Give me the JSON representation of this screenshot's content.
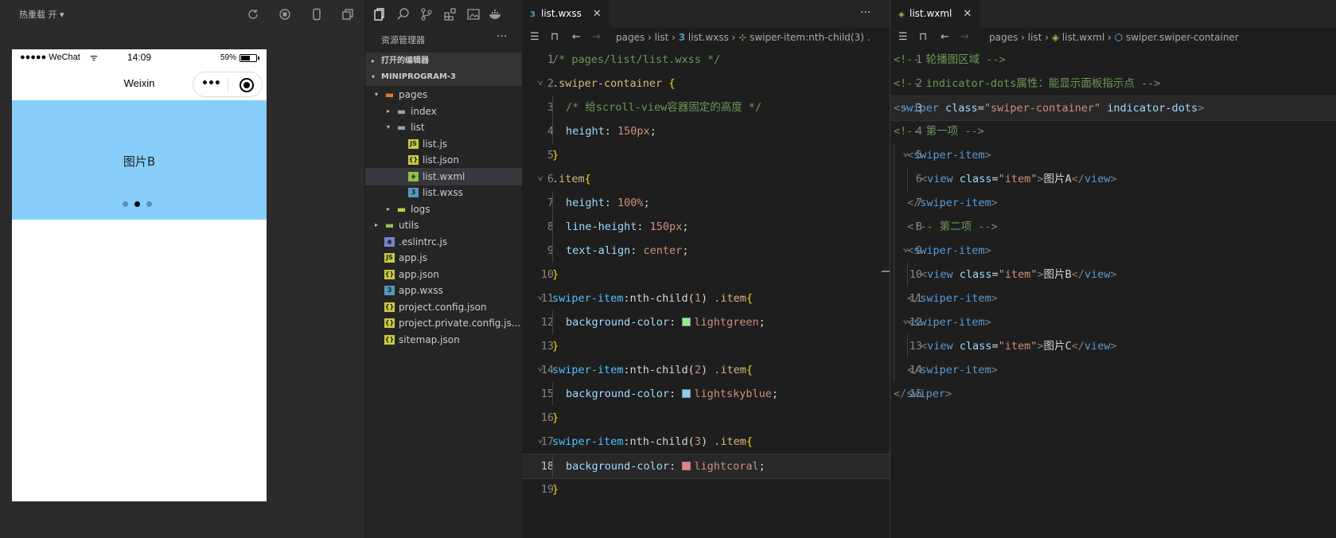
{
  "simulator": {
    "hot_reload": "热重载 开 ▾",
    "status": {
      "carrier": "●●●●● WeChat",
      "time": "14:09",
      "battery": "59%",
      "battery_level": 0.59
    },
    "nav_title": "Weixin",
    "capsule_more": "•••",
    "slide_text": "图片B",
    "dots": {
      "count": 3,
      "active_index": 1
    }
  },
  "explorer": {
    "title": "资源管理器",
    "more": "···",
    "sections": {
      "open_editors": "打开的编辑器",
      "project": "MINIPROGRAM-3"
    },
    "tree": [
      {
        "label": "pages",
        "icon": "folder-icon",
        "color": "#e37933",
        "level": 1,
        "twisty": "▾",
        "selected": false
      },
      {
        "label": "index",
        "icon": "folder-icon",
        "color": "#90a4ae",
        "level": 2,
        "twisty": "▸",
        "selected": false
      },
      {
        "label": "list",
        "icon": "folder-icon",
        "color": "#90a4ae",
        "level": 2,
        "twisty": "▾",
        "selected": false
      },
      {
        "label": "list.js",
        "icon": "js-file-icon",
        "color": "#cbcb41",
        "level": 3,
        "twisty": "",
        "selected": false
      },
      {
        "label": "list.json",
        "icon": "json-file-icon",
        "color": "#cbcb41",
        "level": 3,
        "twisty": "",
        "selected": false
      },
      {
        "label": "list.wxml",
        "icon": "wxml-file-icon",
        "color": "#8dc149",
        "level": 3,
        "twisty": "",
        "selected": true
      },
      {
        "label": "list.wxss",
        "icon": "css-file-icon",
        "color": "#519aba",
        "level": 3,
        "twisty": "",
        "selected": false
      },
      {
        "label": "logs",
        "icon": "folder-icon",
        "color": "#cbcb41",
        "level": 2,
        "twisty": "▸",
        "selected": false
      },
      {
        "label": "utils",
        "icon": "folder-icon",
        "color": "#8dc149",
        "level": 1,
        "twisty": "▸",
        "selected": false
      },
      {
        "label": ".eslintrc.js",
        "icon": "eslint-file-icon",
        "color": "#7986cb",
        "level": 1,
        "twisty": "",
        "selected": false
      },
      {
        "label": "app.js",
        "icon": "js-file-icon",
        "color": "#cbcb41",
        "level": 1,
        "twisty": "",
        "selected": false
      },
      {
        "label": "app.json",
        "icon": "json-file-icon",
        "color": "#cbcb41",
        "level": 1,
        "twisty": "",
        "selected": false
      },
      {
        "label": "app.wxss",
        "icon": "css-file-icon",
        "color": "#519aba",
        "level": 1,
        "twisty": "",
        "selected": false
      },
      {
        "label": "project.config.json",
        "icon": "json-file-icon",
        "color": "#cbcb41",
        "level": 1,
        "twisty": "",
        "selected": false
      },
      {
        "label": "project.private.config.js...",
        "icon": "json-file-icon",
        "color": "#cbcb41",
        "level": 1,
        "twisty": "",
        "selected": false
      },
      {
        "label": "sitemap.json",
        "icon": "json-file-icon",
        "color": "#cbcb41",
        "level": 1,
        "twisty": "",
        "selected": false
      }
    ]
  },
  "editor1": {
    "tab": "list.wxss",
    "tab_icon": "css-file-icon",
    "actions": "···",
    "breadcrumb": [
      "pages",
      "list",
      "list.wxss",
      "swiper-item:nth-child(3) ."
    ],
    "current_line": 18,
    "lines": [
      {
        "n": "1",
        "fold": "",
        "tokens": [
          [
            "/* pages/list/list.wxss */",
            "c-comment"
          ]
        ]
      },
      {
        "n": "2",
        "fold": "˅",
        "tokens": [
          [
            ".swiper-container",
            "c-sel"
          ],
          [
            " ",
            "c-white"
          ],
          [
            "{",
            "c-brace"
          ]
        ]
      },
      {
        "n": "3",
        "fold": "",
        "indent": 1,
        "tokens": [
          [
            "/* 给scroll-view容器固定的高度 */",
            "c-comment"
          ]
        ]
      },
      {
        "n": "4",
        "fold": "",
        "indent": 1,
        "tokens": [
          [
            "height",
            "c-prop"
          ],
          [
            ": ",
            "c-white"
          ],
          [
            "150px",
            "c-val"
          ],
          [
            ";",
            "c-white"
          ]
        ]
      },
      {
        "n": "5",
        "fold": "",
        "tokens": [
          [
            "}",
            "c-brace"
          ]
        ]
      },
      {
        "n": "6",
        "fold": "˅",
        "tokens": [
          [
            ".item",
            "c-sel"
          ],
          [
            "{",
            "c-brace"
          ]
        ]
      },
      {
        "n": "7",
        "fold": "",
        "indent": 1,
        "tokens": [
          [
            "height",
            "c-prop"
          ],
          [
            ": ",
            "c-white"
          ],
          [
            "100%",
            "c-val"
          ],
          [
            ";",
            "c-white"
          ]
        ]
      },
      {
        "n": "8",
        "fold": "",
        "indent": 1,
        "tokens": [
          [
            "line-height",
            "c-prop"
          ],
          [
            ": ",
            "c-white"
          ],
          [
            "150px",
            "c-val"
          ],
          [
            ";",
            "c-white"
          ]
        ]
      },
      {
        "n": "9",
        "fold": "",
        "indent": 1,
        "tokens": [
          [
            "text-align",
            "c-prop"
          ],
          [
            ": ",
            "c-white"
          ],
          [
            "center",
            "c-val"
          ],
          [
            ";",
            "c-white"
          ]
        ]
      },
      {
        "n": "10",
        "fold": "",
        "tokens": [
          [
            "}",
            "c-brace"
          ]
        ]
      },
      {
        "n": "11",
        "fold": "˅",
        "tokens": [
          [
            "swiper-item",
            "c-selb"
          ],
          [
            ":nth-child(",
            "c-white"
          ],
          [
            "1",
            "c-val"
          ],
          [
            ") ",
            "c-white"
          ],
          [
            ".item",
            "c-sel"
          ],
          [
            "{",
            "c-brace"
          ]
        ]
      },
      {
        "n": "12",
        "fold": "",
        "indent": 1,
        "swatch": "#90ee90",
        "tokens": [
          [
            "background-color",
            "c-prop"
          ],
          [
            ": ",
            "c-white"
          ],
          [
            "lightgreen",
            "c-val"
          ],
          [
            ";",
            "c-white"
          ]
        ]
      },
      {
        "n": "13",
        "fold": "",
        "tokens": [
          [
            "}",
            "c-brace"
          ]
        ]
      },
      {
        "n": "14",
        "fold": "˅",
        "tokens": [
          [
            "swiper-item",
            "c-selb"
          ],
          [
            ":nth-child(",
            "c-white"
          ],
          [
            "2",
            "c-val"
          ],
          [
            ") ",
            "c-white"
          ],
          [
            ".item",
            "c-sel"
          ],
          [
            "{",
            "c-brace"
          ]
        ]
      },
      {
        "n": "15",
        "fold": "",
        "indent": 1,
        "swatch": "#87cefa",
        "tokens": [
          [
            "background-color",
            "c-prop"
          ],
          [
            ": ",
            "c-white"
          ],
          [
            "lightskyblue",
            "c-val"
          ],
          [
            ";",
            "c-white"
          ]
        ]
      },
      {
        "n": "16",
        "fold": "",
        "tokens": [
          [
            "}",
            "c-brace"
          ]
        ]
      },
      {
        "n": "17",
        "fold": "˅",
        "tokens": [
          [
            "swiper-item",
            "c-selb"
          ],
          [
            ":nth-child(",
            "c-white"
          ],
          [
            "3",
            "c-val"
          ],
          [
            ") ",
            "c-white"
          ],
          [
            ".item",
            "c-sel"
          ],
          [
            "{",
            "c-brace"
          ]
        ]
      },
      {
        "n": "18",
        "fold": "",
        "indent": 1,
        "swatch": "#f08080",
        "tokens": [
          [
            "background-color",
            "c-prop"
          ],
          [
            ": ",
            "c-white"
          ],
          [
            "lightcoral",
            "c-val"
          ],
          [
            ";",
            "c-white"
          ]
        ]
      },
      {
        "n": "19",
        "fold": "",
        "tokens": [
          [
            "}",
            "c-brace"
          ]
        ]
      }
    ]
  },
  "editor2": {
    "tab": "list.wxml",
    "tab_icon": "wxml-file-icon",
    "close": "✕",
    "breadcrumb": [
      "pages",
      "list",
      "list.wxml",
      "swiper.swiper-container"
    ],
    "current_line": 3,
    "lines": [
      {
        "n": "1",
        "fold": "",
        "tokens": [
          [
            "<!-- 轮播图区域 -->",
            "c-comment"
          ]
        ]
      },
      {
        "n": "2",
        "fold": "",
        "tokens": [
          [
            "<!-- indicator-dots属性：能显示面板指示点 -->",
            "c-comment"
          ]
        ]
      },
      {
        "n": "3",
        "fold": "˅",
        "tokens": [
          [
            "<",
            "c-punc"
          ],
          [
            "swiper",
            "c-tag"
          ],
          [
            " class",
            "c-attr"
          ],
          [
            "=",
            "c-white"
          ],
          [
            "\"swiper-container\"",
            "c-str"
          ],
          [
            " indicator-dots",
            "c-attr"
          ],
          [
            ">",
            "c-punc"
          ]
        ]
      },
      {
        "n": "4",
        "fold": "",
        "tokens": [
          [
            "<!-- 第一项 -->",
            "c-comment"
          ]
        ]
      },
      {
        "n": "5",
        "fold": "˅",
        "indent": 1,
        "tokens": [
          [
            "<",
            "c-punc"
          ],
          [
            "swiper-item",
            "c-tag"
          ],
          [
            ">",
            "c-punc"
          ]
        ]
      },
      {
        "n": "6",
        "fold": "",
        "indent": 2,
        "tokens": [
          [
            "<",
            "c-punc"
          ],
          [
            "view",
            "c-tag"
          ],
          [
            " class",
            "c-attr"
          ],
          [
            "=",
            "c-white"
          ],
          [
            "\"item\"",
            "c-str"
          ],
          [
            ">",
            "c-punc"
          ],
          [
            "图片A",
            "c-white"
          ],
          [
            "</",
            "c-punc"
          ],
          [
            "view",
            "c-tag"
          ],
          [
            ">",
            "c-punc"
          ]
        ]
      },
      {
        "n": "7",
        "fold": "",
        "indent": 1,
        "tokens": [
          [
            "</",
            "c-punc"
          ],
          [
            "swiper-item",
            "c-tag"
          ],
          [
            ">",
            "c-punc"
          ]
        ]
      },
      {
        "n": "8",
        "fold": "",
        "indent": 1,
        "tokens": [
          [
            "<!-- 第二项 -->",
            "c-comment"
          ]
        ]
      },
      {
        "n": "9",
        "fold": "˅",
        "indent": 1,
        "tokens": [
          [
            "<",
            "c-punc"
          ],
          [
            "swiper-item",
            "c-tag"
          ],
          [
            ">",
            "c-punc"
          ]
        ]
      },
      {
        "n": "10",
        "fold": "",
        "indent": 2,
        "tokens": [
          [
            "<",
            "c-punc"
          ],
          [
            "view",
            "c-tag"
          ],
          [
            " class",
            "c-attr"
          ],
          [
            "=",
            "c-white"
          ],
          [
            "\"item\"",
            "c-str"
          ],
          [
            ">",
            "c-punc"
          ],
          [
            "图片B",
            "c-white"
          ],
          [
            "</",
            "c-punc"
          ],
          [
            "view",
            "c-tag"
          ],
          [
            ">",
            "c-punc"
          ]
        ]
      },
      {
        "n": "11",
        "fold": "",
        "indent": 1,
        "tokens": [
          [
            "</",
            "c-punc"
          ],
          [
            "swiper-item",
            "c-tag"
          ],
          [
            ">",
            "c-punc"
          ]
        ]
      },
      {
        "n": "12",
        "fold": "˅",
        "indent": 1,
        "tokens": [
          [
            "<",
            "c-punc"
          ],
          [
            "swiper-item",
            "c-tag"
          ],
          [
            ">",
            "c-punc"
          ]
        ]
      },
      {
        "n": "13",
        "fold": "",
        "indent": 2,
        "tokens": [
          [
            "<",
            "c-punc"
          ],
          [
            "view",
            "c-tag"
          ],
          [
            " class",
            "c-attr"
          ],
          [
            "=",
            "c-white"
          ],
          [
            "\"item\"",
            "c-str"
          ],
          [
            ">",
            "c-punc"
          ],
          [
            "图片C",
            "c-white"
          ],
          [
            "</",
            "c-punc"
          ],
          [
            "view",
            "c-tag"
          ],
          [
            ">",
            "c-punc"
          ]
        ]
      },
      {
        "n": "14",
        "fold": "",
        "indent": 1,
        "tokens": [
          [
            "</",
            "c-punc"
          ],
          [
            "swiper-item",
            "c-tag"
          ],
          [
            ">",
            "c-punc"
          ]
        ]
      },
      {
        "n": "15",
        "fold": "",
        "tokens": [
          [
            "</",
            "c-punc"
          ],
          [
            "swiper",
            "c-tag"
          ],
          [
            ">",
            "c-punc"
          ]
        ]
      }
    ]
  }
}
